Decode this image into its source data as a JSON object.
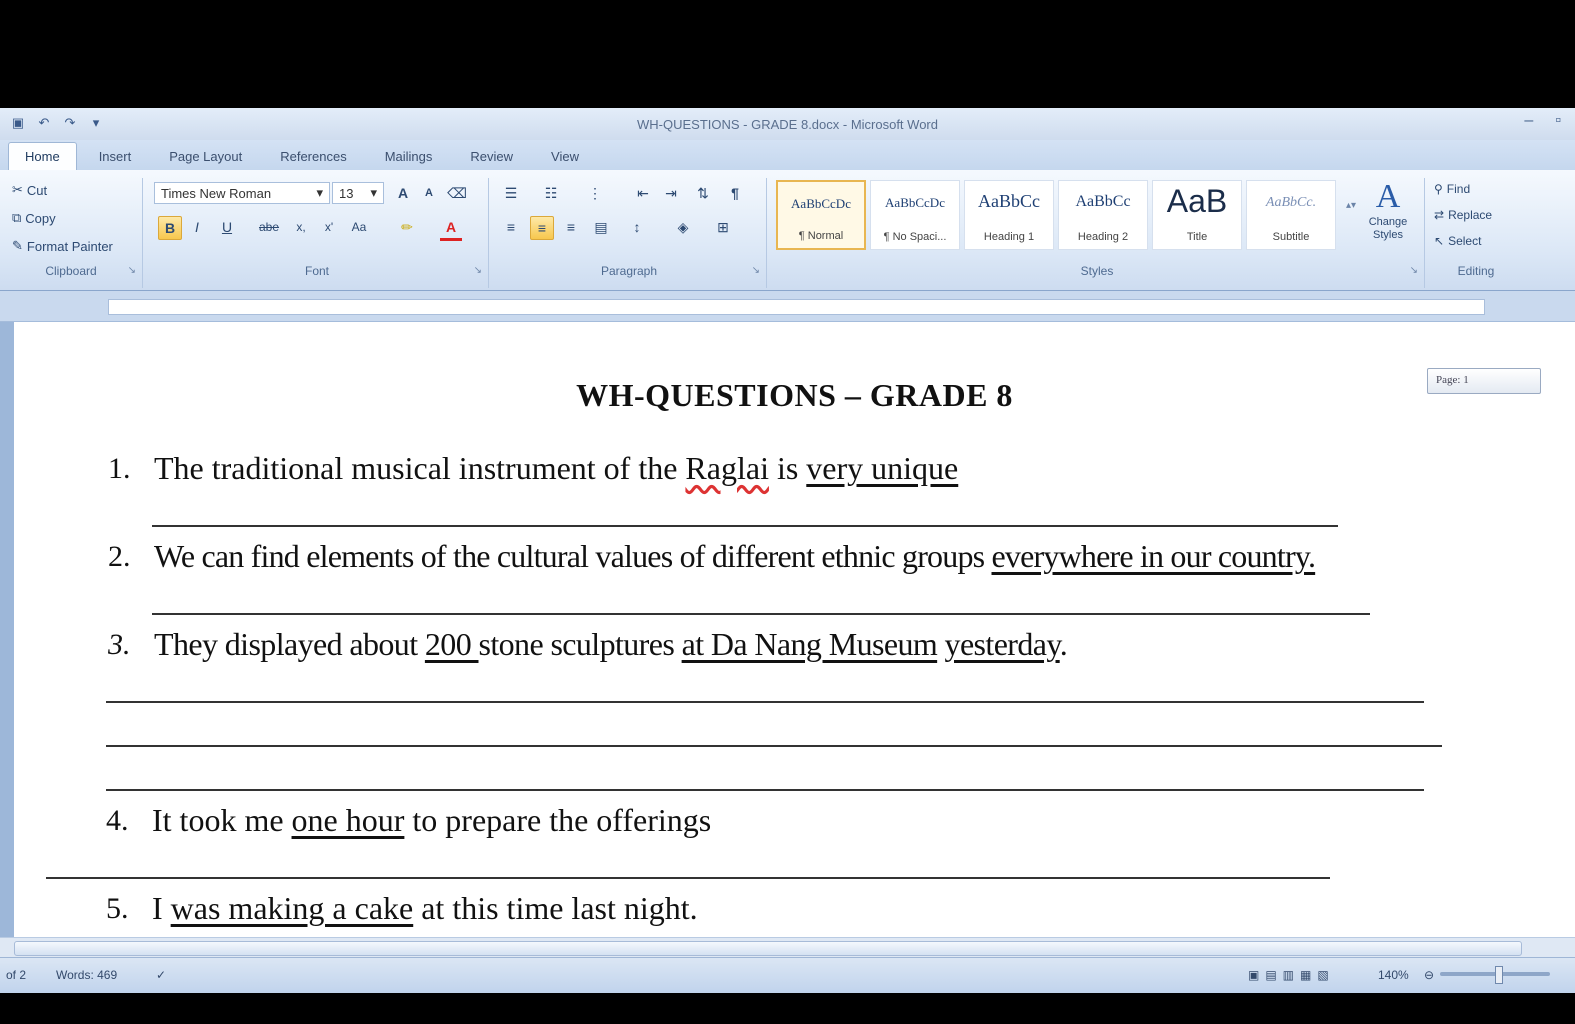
{
  "window": {
    "title": "WH-QUESTIONS - GRADE 8.docx - Microsoft Word",
    "controls": [
      "–",
      "▫"
    ]
  },
  "qat": [
    "save-icon",
    "undo-icon",
    "redo-icon",
    "customize-icon"
  ],
  "tabs": [
    "Home",
    "Insert",
    "Page Layout",
    "References",
    "Mailings",
    "Review",
    "View"
  ],
  "ribbon": {
    "clipboard": {
      "label": "Clipboard",
      "cut": "Cut",
      "copy": "Copy",
      "format_painter": "Format Painter"
    },
    "font": {
      "label": "Font",
      "font_name": "Times New Roman",
      "font_size": "13",
      "grow": "A",
      "shrink": "A",
      "bold": "B",
      "italic": "I",
      "underline": "U",
      "strike": "abe",
      "subscript": "x,",
      "superscript": "x'",
      "change_case": "Aa",
      "font_color": "A"
    },
    "paragraph": {
      "label": "Paragraph",
      "pilcrow": "¶"
    },
    "styles": {
      "label": "Styles",
      "tiles": [
        {
          "sample": "AaBbCcDc",
          "name": "¶ Normal"
        },
        {
          "sample": "AaBbCcDc",
          "name": "¶ No Spaci..."
        },
        {
          "sample": "AaBbCc",
          "name": "Heading 1"
        },
        {
          "sample": "AaBbCc",
          "name": "Heading 2"
        },
        {
          "sample": "AaB",
          "name": "Title"
        },
        {
          "sample": "AaBbCc.",
          "name": "Subtitle"
        }
      ],
      "change_styles": "Change Styles"
    },
    "editing": {
      "label": "Editing",
      "find": "Find",
      "replace": "Replace",
      "select": "Select"
    }
  },
  "page_tip": "Page: 1",
  "document": {
    "heading": "WH-QUESTIONS – GRADE 8",
    "q1": {
      "num": "1.",
      "a": "The traditional musical instrument of the ",
      "b": "Raglai",
      "c": " is ",
      "d": "very unique"
    },
    "q2": {
      "num": "2.",
      "a": "We can find elements of the cultural values of different ethnic groups ",
      "b": "everywhere in our country."
    },
    "q3": {
      "num": "3.",
      "a": "They displayed about ",
      "b": "200 ",
      "c": "stone sculptures ",
      "d": "at Da Nang Museum",
      "e": " ",
      "f": "yesterday",
      "g": "."
    },
    "q4": {
      "num": "4.",
      "a": "It took me ",
      "b": "one hour",
      "c": " to prepare the offerings"
    },
    "q5": {
      "num": "5.",
      "a": "I ",
      "b": "was making a cake",
      "c": " at this time last night."
    }
  },
  "status": {
    "page": "of 2",
    "words": "Words: 469",
    "zoom": "140%"
  }
}
